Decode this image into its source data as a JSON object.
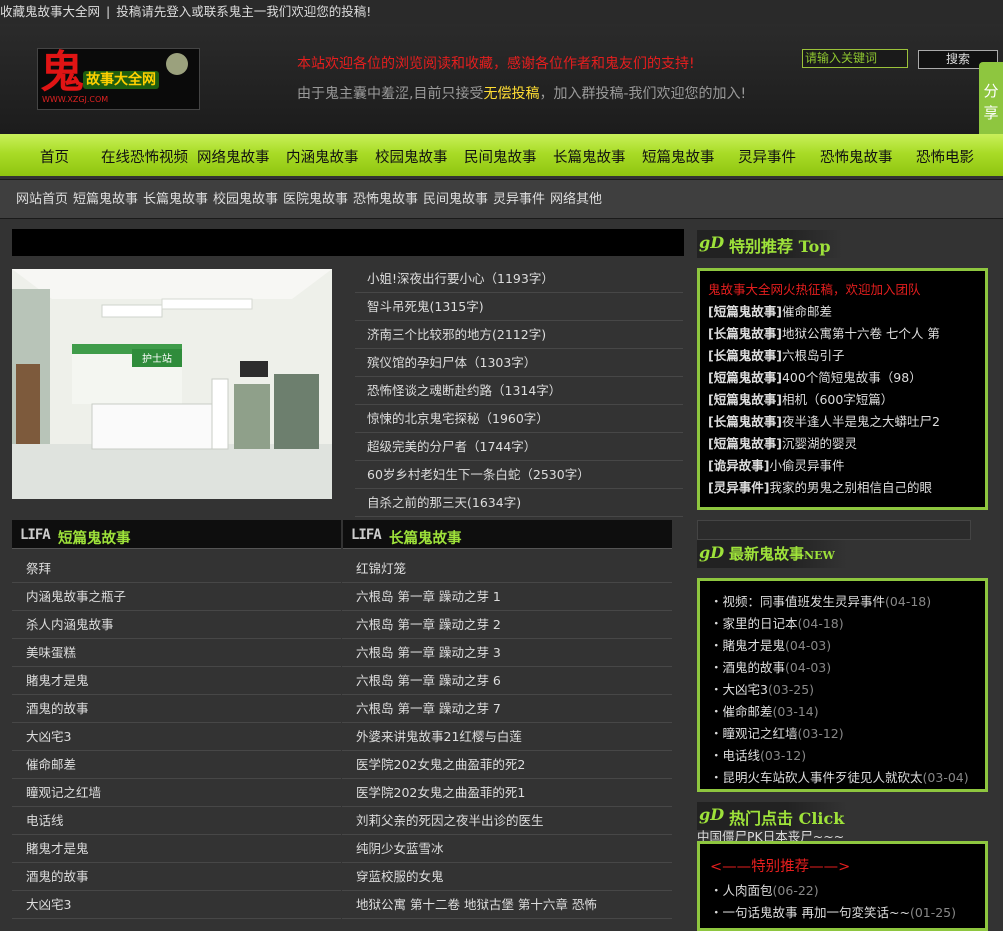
{
  "topbar": {
    "bookmark": "收藏鬼故事大全网",
    "separator": "|",
    "notice": "投稿请先登入或联系鬼主一我们欢迎您的投稿!"
  },
  "header": {
    "logo": {
      "glyph": "鬼",
      "sub": "故事大全网",
      "url": "WWW.XZGJ.COM"
    },
    "welcome_line1": "本站欢迎各位的浏览阅读和收藏，感谢各位作者和鬼友们的支持!",
    "welcome_line2_pre": "由于鬼主囊中羞涩,目前只接受",
    "welcome_line2_hl": "无偿投稿",
    "welcome_line2_post": "，加入群投稿-我们欢迎您的加入!",
    "search_placeholder": "请输入关键词",
    "search_button": "搜索",
    "share": "分享"
  },
  "nav": [
    {
      "label": "首页",
      "name": "nav-home"
    },
    {
      "label": "在线恐怖视频",
      "name": "nav-horror-videos"
    },
    {
      "label": "网络鬼故事",
      "name": "nav-internet-stories"
    },
    {
      "label": "内涵鬼故事",
      "name": "nav-neihan-stories"
    },
    {
      "label": "校园鬼故事",
      "name": "nav-campus-stories"
    },
    {
      "label": "民间鬼故事",
      "name": "nav-folk-stories"
    },
    {
      "label": "长篇鬼故事",
      "name": "nav-long-stories"
    },
    {
      "label": "短篇鬼故事",
      "name": "nav-short-stories"
    },
    {
      "label": "灵异事件",
      "name": "nav-supernatural-events"
    },
    {
      "label": "恐怖鬼故事",
      "name": "nav-horror-stories"
    },
    {
      "label": "恐怖电影",
      "name": "nav-horror-movies"
    }
  ],
  "crumbs": [
    "网站首页",
    "短篇鬼故事",
    "长篇鬼故事",
    "校园鬼故事",
    "医院鬼故事",
    "恐怖鬼故事",
    "民间鬼故事",
    "灵异事件",
    "网络其他"
  ],
  "feature": {
    "image_sign": "护士站",
    "items": [
      "小姐!深夜出行要小心（1193字）",
      "智斗吊死鬼(1315字)",
      "济南三个比较邪的地方(2112字)",
      "殡仪馆的孕妇尸体（1303字）",
      "恐怖怪谈之魂断赴约路（1314字）",
      "惊悚的北京鬼宅探秘（1960字）",
      "超级完美的分尸者（1744字）",
      "60岁乡村老妇生下一条白蛇（2530字）",
      "自杀之前的那三天(1634字)"
    ]
  },
  "short_col": {
    "mark": "LIFA",
    "title": "短篇鬼故事",
    "items": [
      "祭拜",
      "内涵鬼故事之瓶子",
      "杀人内涵鬼故事",
      "美味蛋糕",
      "賭鬼才是鬼",
      "酒鬼的故事",
      "大凶宅3",
      "催命邮差",
      "瞳观记之红墙",
      "电话线",
      "賭鬼才是鬼",
      "酒鬼的故事",
      "大凶宅3"
    ]
  },
  "long_col": {
    "mark": "LIFA",
    "title": "长篇鬼故事",
    "items": [
      "红锦灯笼",
      "六根岛 第一章 躁动之芽 1",
      "六根岛 第一章 躁动之芽 2",
      "六根岛 第一章 躁动之芽 3",
      "六根岛 第一章 躁动之芽 6",
      "六根岛 第一章 躁动之芽 7",
      "外婆来讲鬼故事21红樱与白莲",
      "医学院202女鬼之曲盈菲的死2",
      "医学院202女鬼之曲盈菲的死1",
      "刘莉父亲的死因之夜半出诊的医生",
      "纯阴少女蓝雪冰",
      "穿蓝校服的女鬼",
      "地狱公寓 第十二卷 地狱古堡 第十六章 恐怖"
    ]
  },
  "sidebar": {
    "recommend_title": "特别推荐",
    "recommend_title_en": "Top",
    "recommend_logo": "gD",
    "recommend_banner": "鬼故事大全网火热征稿，欢迎加入团队",
    "recommend_items": [
      {
        "cat": "[短篇鬼故事]",
        "title": "催命邮差"
      },
      {
        "cat": "[长篇鬼故事]",
        "title": "地狱公寓第十六卷 七个人 第"
      },
      {
        "cat": "[长篇鬼故事]",
        "title": "六根岛引子"
      },
      {
        "cat": "[短篇鬼故事]",
        "title": "400个简短鬼故事（98）"
      },
      {
        "cat": "[短篇鬼故事]",
        "title": "相机（600字短篇）"
      },
      {
        "cat": "[长篇鬼故事]",
        "title": "夜半逢人半是鬼之大蟒吐尸2"
      },
      {
        "cat": "[短篇鬼故事]",
        "title": "沉婴湖的婴灵"
      },
      {
        "cat": "[诡异故事]",
        "title": "小偷灵异事件"
      },
      {
        "cat": "[灵异事件]",
        "title": "我家的男鬼之别相信自己的眼"
      }
    ],
    "latest_title": "最新鬼故事",
    "latest_title_en": "NEW",
    "latest_logo": "gD",
    "latest_items": [
      {
        "title": "视频：同事值班发生灵异事件",
        "date": "(04-18)"
      },
      {
        "title": "家里的日记本",
        "date": "(04-18)"
      },
      {
        "title": "賭鬼才是鬼",
        "date": "(04-03)"
      },
      {
        "title": "酒鬼的故事",
        "date": "(04-03)"
      },
      {
        "title": "大凶宅3",
        "date": "(03-25)"
      },
      {
        "title": "催命邮差",
        "date": "(03-14)"
      },
      {
        "title": "瞳观记之红墙",
        "date": "(03-12)"
      },
      {
        "title": "电话线",
        "date": "(03-12)"
      },
      {
        "title": "昆明火车站砍人事件歹徒见人就砍太",
        "date": "(03-04)"
      }
    ],
    "hot_title": "热门点击",
    "hot_title_en": "Click",
    "hot_logo": "gD",
    "hot_note": "中国僵尸PK日本丧尸~~~",
    "hot_special": "<——特别推荐——>",
    "hot_items": [
      {
        "title": "人肉面包",
        "date": "(06-22)"
      },
      {
        "title": "一句话鬼故事 再加一句変笑话~~",
        "date": "(01-25)"
      }
    ]
  }
}
